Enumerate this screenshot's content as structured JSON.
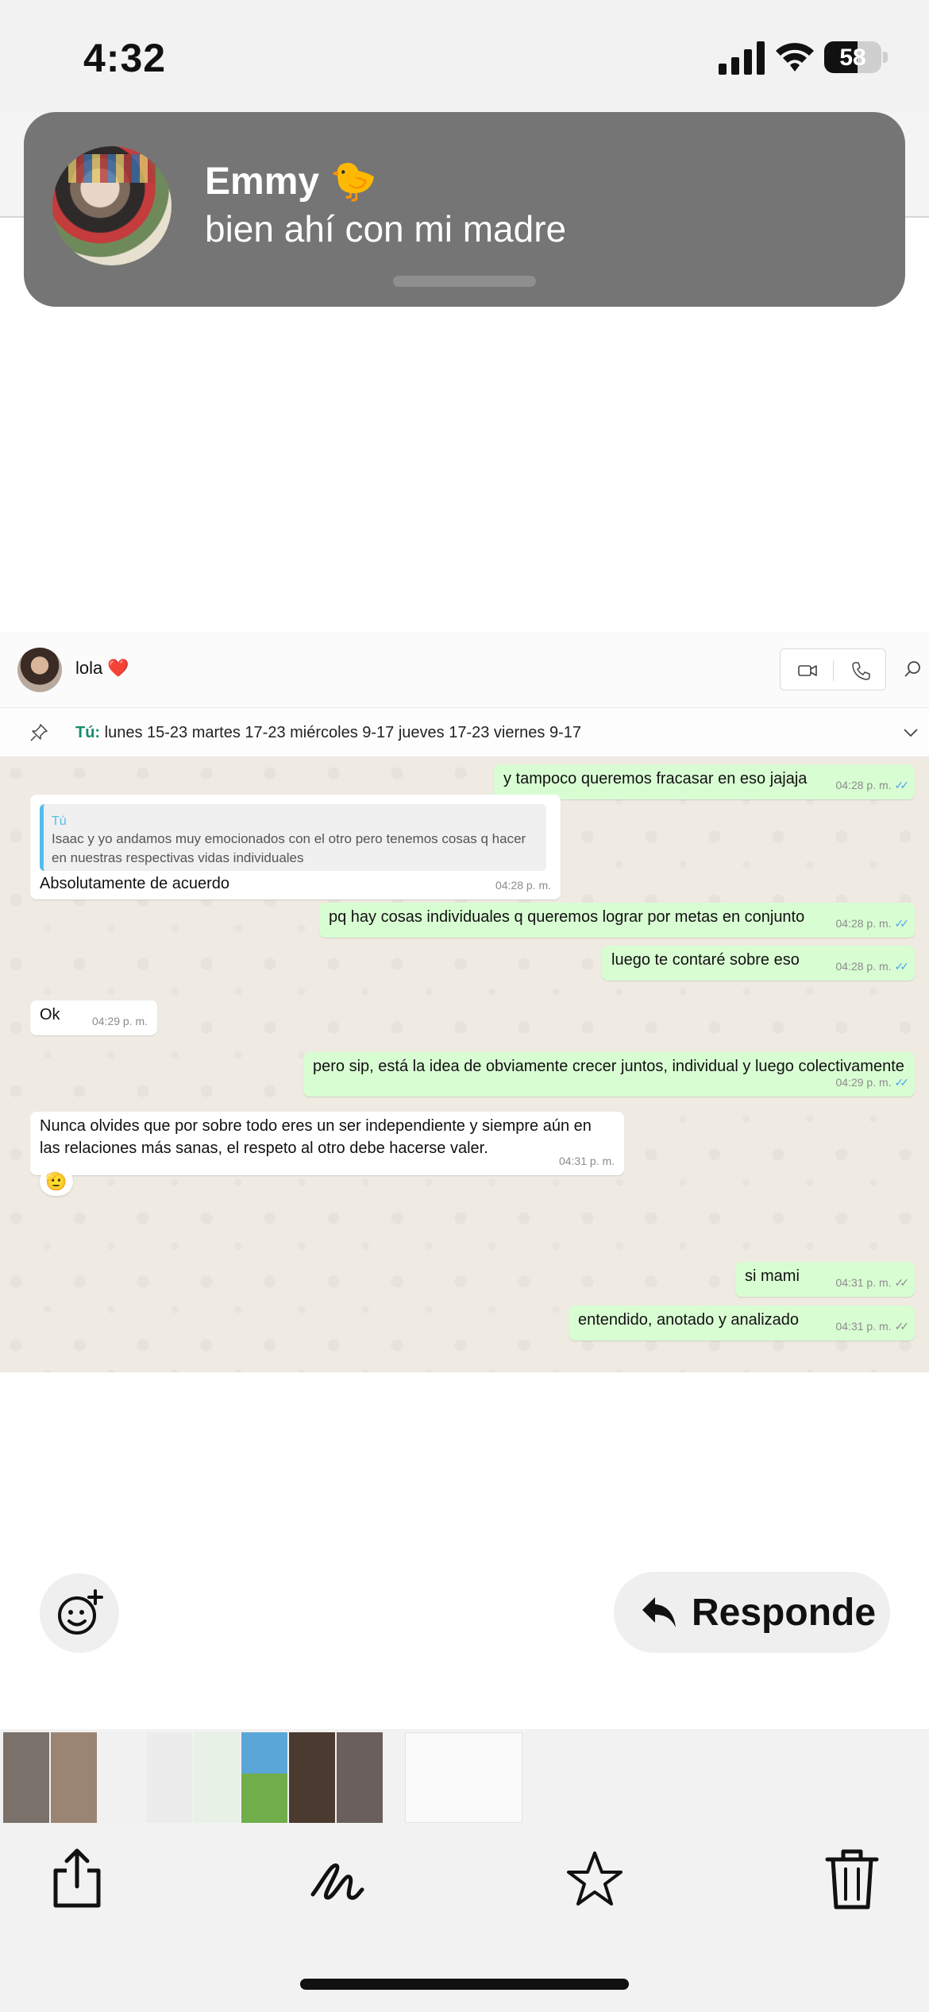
{
  "status_bar": {
    "time": "4:32",
    "battery": "58"
  },
  "notification": {
    "title": "Emmy 🐤",
    "body": "bien ahí con mi madre"
  },
  "chat": {
    "contact_name": "lola ❤️",
    "pinned": {
      "author": "Tú:",
      "text": " lunes 15-23 martes 17-23 miércoles 9-17 jueves 17-23 viernes 9-17"
    },
    "messages": [
      {
        "dir": "out",
        "text": "y tampoco queremos fracasar en eso jajaja",
        "time": "04:28 p. m.",
        "status": "read"
      },
      {
        "dir": "in",
        "quote_author": "Tú",
        "quote_text": "Isaac y yo andamos muy emocionados con el otro pero tenemos cosas q hacer en nuestras respectivas vidas individuales",
        "text": "Absolutamente de acuerdo",
        "time": "04:28 p. m."
      },
      {
        "dir": "out",
        "text": "pq hay cosas individuales q queremos lograr por metas en conjunto",
        "time": "04:28 p. m.",
        "status": "read"
      },
      {
        "dir": "out",
        "text": "luego te contaré sobre eso",
        "time": "04:28 p. m.",
        "status": "read"
      },
      {
        "dir": "in",
        "text": "Ok",
        "time": "04:29 p. m."
      },
      {
        "dir": "out",
        "text": "pero sip, está la idea de obviamente crecer juntos, individual y luego colectivamente",
        "time": "04:29 p. m.",
        "status": "read"
      },
      {
        "dir": "in",
        "text": "Nunca olvides que por sobre todo eres un ser independiente y siempre aún en las relaciones más sanas, el respeto al otro debe hacerse valer.",
        "time": "04:31 p. m.",
        "reaction": "🫡"
      },
      {
        "dir": "out",
        "text": "si mami",
        "time": "04:31 p. m.",
        "status": "sent"
      },
      {
        "dir": "out",
        "text": "entendido, anotado y analizado",
        "time": "04:31 p. m.",
        "status": "sent"
      }
    ]
  },
  "actions": {
    "reply_label": "Responde"
  },
  "icons": {
    "notification_avatar": "contact-photo",
    "emoji_add": "add-reaction-icon",
    "reply": "reply-arrow-icon",
    "toolbar": [
      "share-icon",
      "markup-icon",
      "favorite-star-icon",
      "trash-icon"
    ]
  },
  "colors": {
    "outgoing_bubble": "#d9fdd3",
    "incoming_bubble": "#ffffff",
    "chat_background": "#efeae2",
    "read_ticks": "#4ea6e8",
    "pinned_author": "#168c6a"
  }
}
